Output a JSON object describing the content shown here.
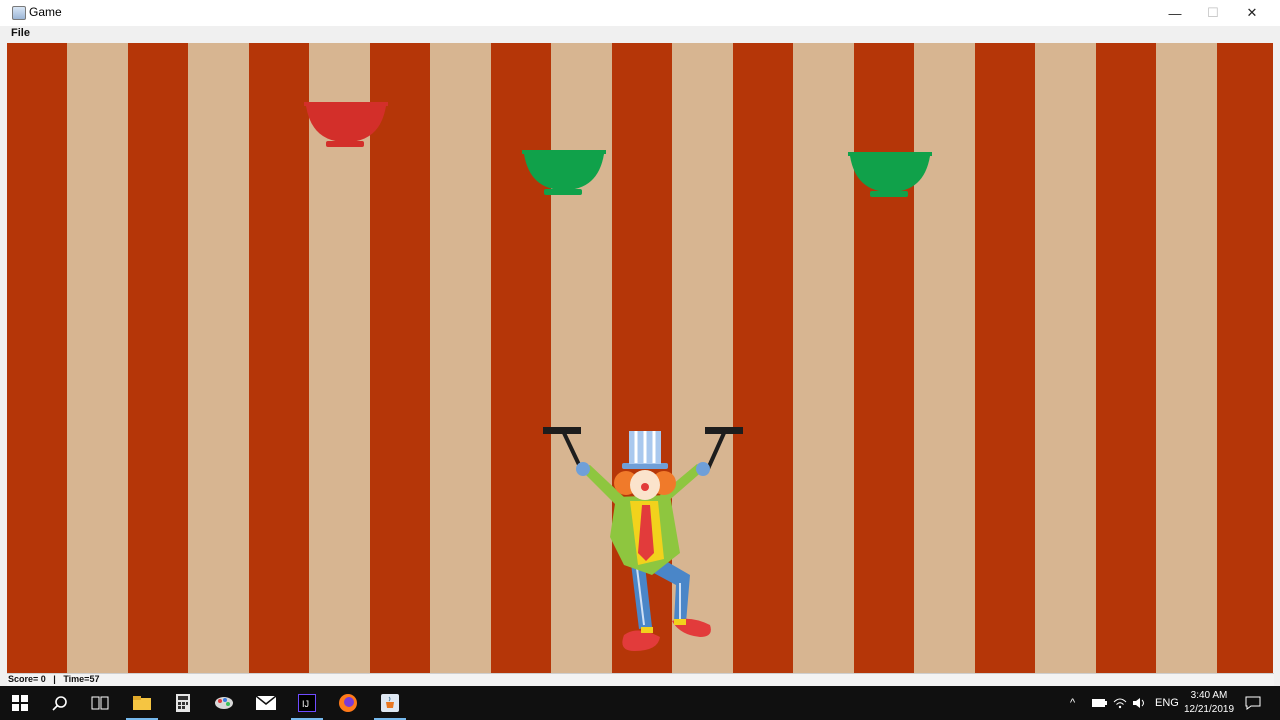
{
  "window": {
    "title": "Game",
    "icon": "java-cup-icon",
    "controls": {
      "minimize": "—",
      "maximize": "☐",
      "close": "✕"
    }
  },
  "menu": {
    "items": [
      "File"
    ]
  },
  "game": {
    "background": {
      "stripe_dark": "#b53608",
      "stripe_light": "#d7b591"
    },
    "bowls": [
      {
        "color": "#d32f2a",
        "name": "red-bowl"
      },
      {
        "color": "#10a14a",
        "name": "green-bowl"
      },
      {
        "color": "#10a14a",
        "name": "green-bowl"
      }
    ],
    "player": {
      "name": "clown"
    }
  },
  "status": {
    "score_label": "Score= 0",
    "separator": "|",
    "time_label": "Time=57"
  },
  "taskbar": {
    "icons": [
      "windows-start-icon",
      "search-icon",
      "task-view-icon",
      "file-explorer-icon",
      "calculator-icon",
      "paint-icon",
      "mail-icon",
      "intellij-icon",
      "firefox-icon",
      "java-app-icon"
    ],
    "tray": {
      "chevron": "^",
      "language": "ENG"
    },
    "clock": {
      "time": "3:40 AM",
      "date": "12/21/2019"
    }
  }
}
